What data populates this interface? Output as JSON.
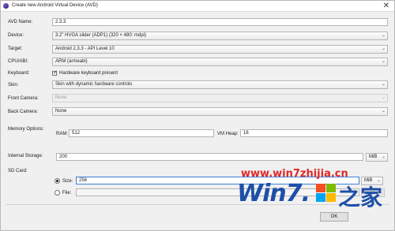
{
  "window": {
    "title": "Create new Android Virtual Device (AVD)",
    "close_glyph": "✕"
  },
  "form": {
    "avd_name": {
      "label": "AVD Name:",
      "value": "2.3.3"
    },
    "device": {
      "label": "Device:",
      "value": "3.2\" HVGA slider (ADP1) (320 × 480: mdpi)"
    },
    "target": {
      "label": "Target:",
      "value": "Android 2.3.3 - API Level 10"
    },
    "cpu_abi": {
      "label": "CPU/ABI:",
      "value": "ARM (armeabi)"
    },
    "keyboard": {
      "label": "Keyboard:",
      "checkbox_label": "Hardware keyboard present",
      "checked": true
    },
    "skin": {
      "label": "Skin:",
      "value": "Skin with dynamic hardware controls"
    },
    "front_camera": {
      "label": "Front Camera:",
      "value": "None",
      "disabled": true
    },
    "back_camera": {
      "label": "Back Camera:",
      "value": "None"
    },
    "memory_options": {
      "label": "Memory Options:",
      "ram_label": "RAM:",
      "ram_value": "512",
      "vm_heap_label": "VM Heap:",
      "vm_heap_value": "16"
    },
    "internal_storage": {
      "label": "Internal Storage:",
      "value": "200",
      "unit": "MiB"
    },
    "sd_card": {
      "label": "SD Card:",
      "size_label": "Size:",
      "size_value": "256",
      "size_unit": "MiB",
      "file_label": "File:",
      "file_value": "",
      "browse_label": "Browse...",
      "selected": "size"
    }
  },
  "buttons": {
    "ok": "OK"
  },
  "watermark": {
    "url": "www.win7zhijia.cn",
    "brand": "Win7.",
    "brand_cn": "之家"
  },
  "colors": {
    "watermark_red": "#e02828",
    "watermark_blue": "#1e4fa8"
  },
  "icons": {
    "app": "android-sdk-icon",
    "dropdown": "chevron-down-icon",
    "close": "close-icon"
  }
}
